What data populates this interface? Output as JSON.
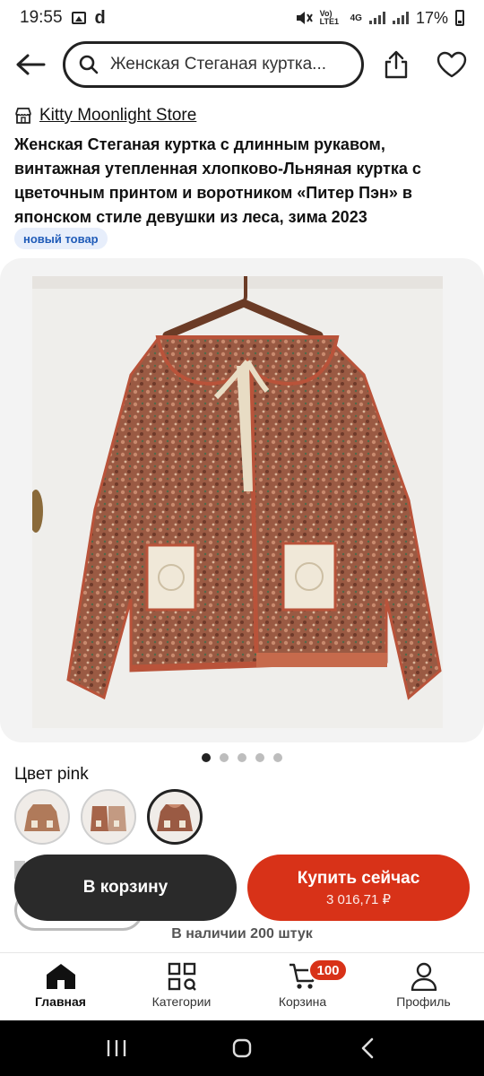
{
  "status_bar": {
    "time": "19:55",
    "d_glyph": "d",
    "network_label": "4G",
    "volte_label": "Vo) LTE1",
    "battery": "17%"
  },
  "search": {
    "query": "Женская Стеганая куртка..."
  },
  "store": {
    "name": "Kitty Moonlight Store"
  },
  "product": {
    "title": "Женская Стеганая куртка с длинным рукавом, винтажная утепленная хлопково-Льняная куртка с цветочным принтом и воротником «Питер Пэн» в японском стиле девушки из леса, зима 2023",
    "badge": "новый товар"
  },
  "gallery": {
    "total": 5,
    "active_index": 0
  },
  "color": {
    "label": "Цвет pink",
    "options": [
      "option 1",
      "option 2",
      "pink"
    ],
    "selected_index": 2
  },
  "actions": {
    "add_to_cart": "В корзину",
    "buy_now": "Купить сейчас",
    "price": "3 016,71 ₽"
  },
  "stock": "В наличии 200 штук",
  "nav": {
    "items": [
      {
        "label": "Главная",
        "icon": "home-icon",
        "active": true
      },
      {
        "label": "Категории",
        "icon": "categories-icon",
        "active": false
      },
      {
        "label": "Корзина",
        "icon": "cart-icon",
        "active": false
      },
      {
        "label": "Профиль",
        "icon": "profile-icon",
        "active": false
      }
    ],
    "cart_count": "100"
  },
  "colors": {
    "accent": "#d83218",
    "dark": "#2a2a2a",
    "badge_bg": "#e7eefb",
    "badge_text": "#1f5bb8"
  }
}
